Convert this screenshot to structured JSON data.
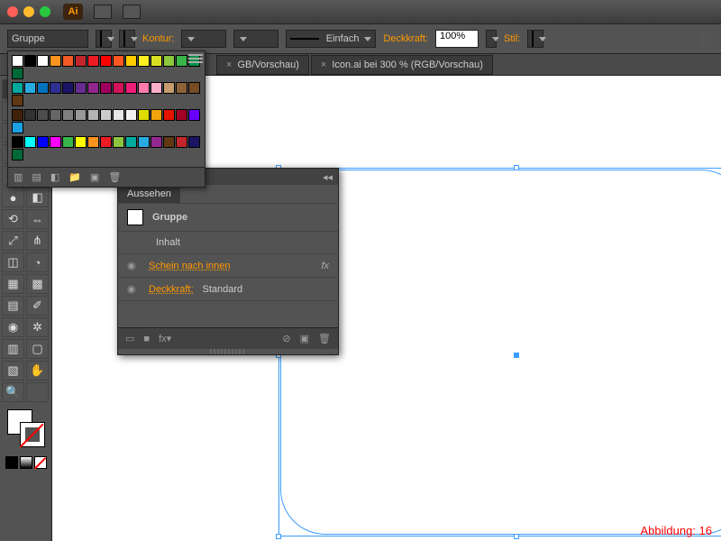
{
  "app": {
    "logo": "Ai"
  },
  "control": {
    "selection": "Gruppe",
    "stroke_label": "Kontur:",
    "stroke_style": "Einfach",
    "opacity_label": "Deckkraft:",
    "opacity_value": "100%",
    "style_label": "Stil:"
  },
  "tabs": [
    {
      "label": "GB/Vorschau)",
      "close": "×"
    },
    {
      "label": "Icon.ai bei 300 % (RGB/Vorschau)",
      "close": "×"
    }
  ],
  "swatch_rows": [
    [
      "#fff",
      "#000",
      "#fff",
      "#f7931e",
      "#f15a24",
      "#c1272d",
      "#ed1c24",
      "#ff0000",
      "#ff5722",
      "#ffcc00",
      "#fcee21",
      "#d9e021",
      "#8cc63f",
      "#39b54a",
      "#009245",
      "#006837"
    ],
    [
      "#00a99d",
      "#29abe2",
      "#0071bc",
      "#2e3192",
      "#1b1464",
      "#662d91",
      "#93278f",
      "#9e005d",
      "#d4145a",
      "#ed1e79",
      "#ff7bac",
      "#ffaec9",
      "#c69c6d",
      "#8c6239",
      "#754c24",
      "#603813"
    ],
    [
      "#42210b",
      "#333",
      "#4d4d4d",
      "#666",
      "#808080",
      "#999",
      "#b3b3b3",
      "#ccc",
      "#e6e6e6",
      "#f2f2f2",
      "#dedc00",
      "#f0a30a",
      "#e51400",
      "#a20025",
      "#6a00ff",
      "#1ba1e2"
    ],
    [
      "#000",
      "#0ff",
      "#00f",
      "#f0f",
      "#39b54a",
      "#ff0",
      "#f7931e",
      "#ed1c24",
      "#8cc63f",
      "#00a99d",
      "#29abe2",
      "#93278f",
      "#603813",
      "#c1272d",
      "#1b1464",
      "#006837"
    ]
  ],
  "appearance": {
    "title": "Aussehen",
    "group": "Gruppe",
    "content": "Inhalt",
    "inner_glow": "Schein nach innen",
    "opacity": "Deckkraft:",
    "opacity_val": "Standard",
    "fx": "fx"
  },
  "caption": "Abbildung: 16"
}
